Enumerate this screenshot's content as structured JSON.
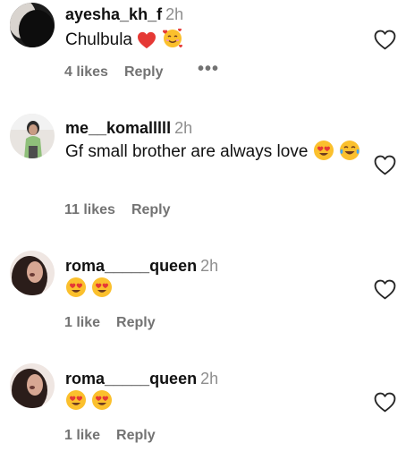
{
  "comments": [
    {
      "username": "ayesha_kh_f",
      "time": "2h",
      "text": "Chulbula",
      "emojis": [
        "red-heart",
        "smiling-face-with-hearts"
      ],
      "likes": "4 likes",
      "reply": "Reply",
      "more": "•••"
    },
    {
      "username": "me__komalllll",
      "time": "2h",
      "text": "Gf small brother are always love",
      "emojis": [
        "heart-eyes",
        "tears-of-joy"
      ],
      "likes": "11 likes",
      "reply": "Reply"
    },
    {
      "username": "roma_____queen",
      "time": "2h",
      "text": "",
      "emojis": [
        "heart-eyes",
        "heart-eyes"
      ],
      "likes": "1 like",
      "reply": "Reply"
    },
    {
      "username": "roma_____queen",
      "time": "2h",
      "text": "",
      "emojis": [
        "heart-eyes",
        "heart-eyes"
      ],
      "likes": "1 like",
      "reply": "Reply"
    }
  ],
  "colors": {
    "text": "#111111",
    "muted": "#737373",
    "time": "#8e8e8e",
    "emoji_yellow": "#fbc02d",
    "emoji_heart": "#e53935"
  }
}
